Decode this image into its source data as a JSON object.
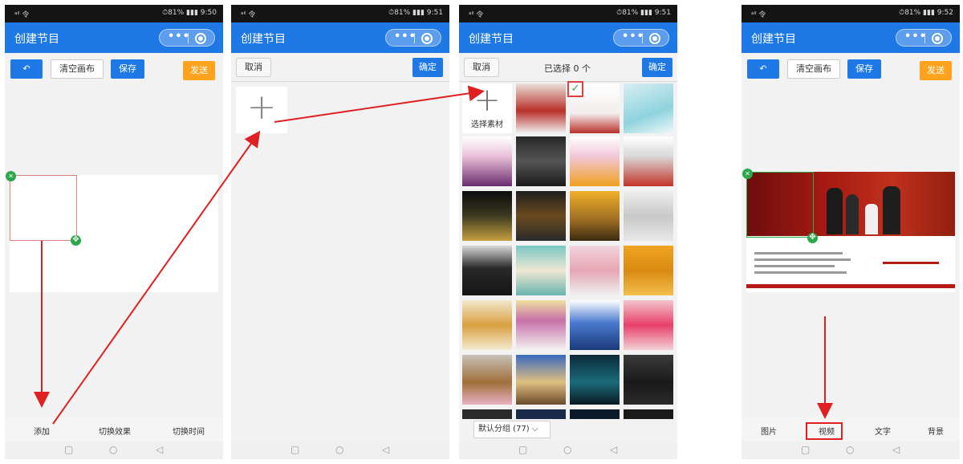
{
  "common": {
    "status_signal": "ᵃˡˡ 令",
    "app_title": "创建节目",
    "capsule_dots": "•••"
  },
  "screens": [
    {
      "status_right": "⏱81% ▮▮▮ 9:50",
      "toolbar": {
        "undo": "↶",
        "clear": "清空画布",
        "save": "保存",
        "send": "发送"
      },
      "bottom_tabs": [
        "添加",
        "切换效果",
        "切换时间"
      ]
    },
    {
      "status_right": "⏱81% ▮▮▮ 9:51",
      "toolbar": {
        "cancel": "取消",
        "confirm": "确定"
      },
      "add_tile": "+"
    },
    {
      "status_right": "⏱81% ▮▮▮ 9:51",
      "toolbar": {
        "cancel": "取消",
        "count": "已选择 0 个",
        "confirm": "确定"
      },
      "add_cell": {
        "plus": "+",
        "label": "选择素材"
      },
      "check": "✓",
      "group": "默认分组 (77) ⌵"
    },
    {
      "status_right": "⏱81% ▮▮▮ 9:52",
      "toolbar": {
        "undo": "↶",
        "clear": "清空画布",
        "save": "保存",
        "send": "发送"
      },
      "bottom_tabs": [
        "图片",
        "视频",
        "文字",
        "背景"
      ]
    }
  ],
  "nav_icons": {
    "square": "▢",
    "circle": "○",
    "back": "◁"
  },
  "colors": {
    "header_blue": "#1e78e6",
    "send_orange": "#ffa21e",
    "handle_green": "#2ba84a",
    "annotation_red": "#e02020"
  }
}
